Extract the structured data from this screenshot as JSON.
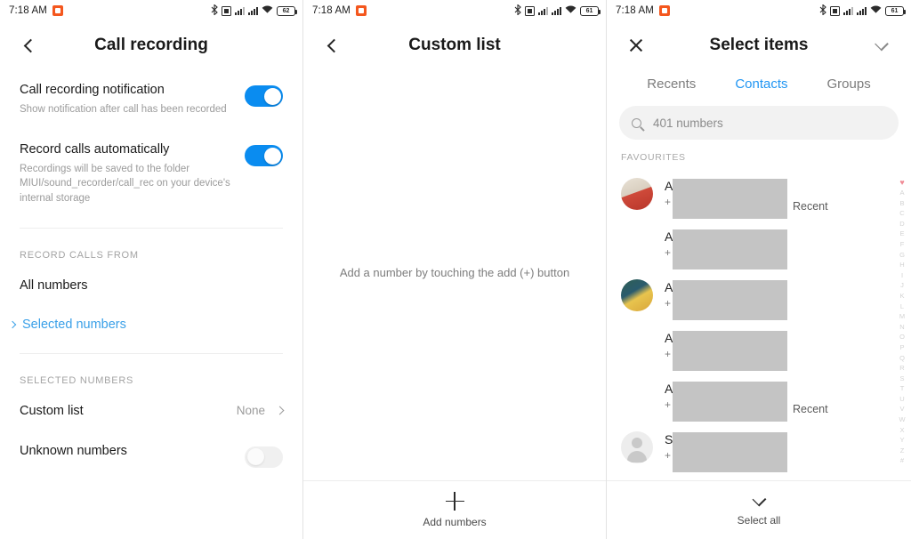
{
  "status_bar": {
    "time": "7:18 AM",
    "app_icon": "notification-app-icon",
    "icons": [
      "bluetooth-icon",
      "sd-card-icon",
      "signal-1-icon",
      "signal-2-icon",
      "wifi-icon",
      "battery-icon"
    ],
    "battery_panel_1": "62",
    "battery_panel_2": "61",
    "battery_panel_3": "61"
  },
  "panel_call_recording": {
    "back_icon": "back-chevron-icon",
    "title": "Call recording",
    "settings": [
      {
        "title": "Call recording notification",
        "subtitle": "Show notification after call has been recorded",
        "toggle": "on"
      },
      {
        "title": "Record calls automatically",
        "subtitle": "Recordings will be saved to the folder MIUI/sound_recorder/call_rec on your device's internal storage",
        "toggle": "on"
      }
    ],
    "section_record_from": "RECORD CALLS FROM",
    "options": [
      {
        "label": "All numbers",
        "selected": false
      },
      {
        "label": "Selected numbers",
        "selected": true
      }
    ],
    "section_selected": "SELECTED NUMBERS",
    "custom_list": {
      "label": "Custom list",
      "value": "None"
    },
    "unknown_numbers": {
      "label": "Unknown numbers",
      "toggle": "off"
    }
  },
  "panel_custom_list": {
    "back_icon": "back-chevron-icon",
    "title": "Custom list",
    "empty_message": "Add a number by touching the add (+) button",
    "bottom_action": {
      "icon": "plus-icon",
      "label": "Add numbers"
    }
  },
  "panel_select_items": {
    "close_icon": "close-x-icon",
    "title": "Select items",
    "confirm_icon": "check-icon",
    "tabs": [
      {
        "label": "Recents",
        "active": false
      },
      {
        "label": "Contacts",
        "active": true
      },
      {
        "label": "Groups",
        "active": false
      }
    ],
    "search": {
      "icon": "search-icon",
      "placeholder": "401 numbers"
    },
    "section_favourites": "FAVOURITES",
    "contacts": [
      {
        "name": "A",
        "number": "+",
        "avatar": "photo",
        "badge": "Recent"
      },
      {
        "name": "A",
        "number": "+",
        "avatar": "none",
        "badge": ""
      },
      {
        "name": "A",
        "number": "+",
        "avatar": "photo2",
        "badge": ""
      },
      {
        "name": "A",
        "number": "+",
        "avatar": "none",
        "badge": ""
      },
      {
        "name": "A",
        "number": "+",
        "avatar": "none",
        "badge": "Recent"
      },
      {
        "name": "S",
        "number": "+",
        "avatar": "placeholder",
        "badge": ""
      }
    ],
    "index": [
      "A",
      "B",
      "C",
      "D",
      "E",
      "F",
      "G",
      "H",
      "I",
      "J",
      "K",
      "L",
      "M",
      "N",
      "O",
      "P",
      "Q",
      "R",
      "S",
      "T",
      "U",
      "V",
      "W",
      "X",
      "Y",
      "Z",
      "#"
    ],
    "index_heart": "♥",
    "bottom_action": {
      "icon": "check-icon",
      "label": "Select all"
    }
  },
  "colors": {
    "accent_blue": "#0a8cf0",
    "link_blue": "#3aa0e8",
    "tab_active": "#2196f3",
    "status_orange": "#f4571e",
    "redaction_gray": "#c4c4c4"
  }
}
